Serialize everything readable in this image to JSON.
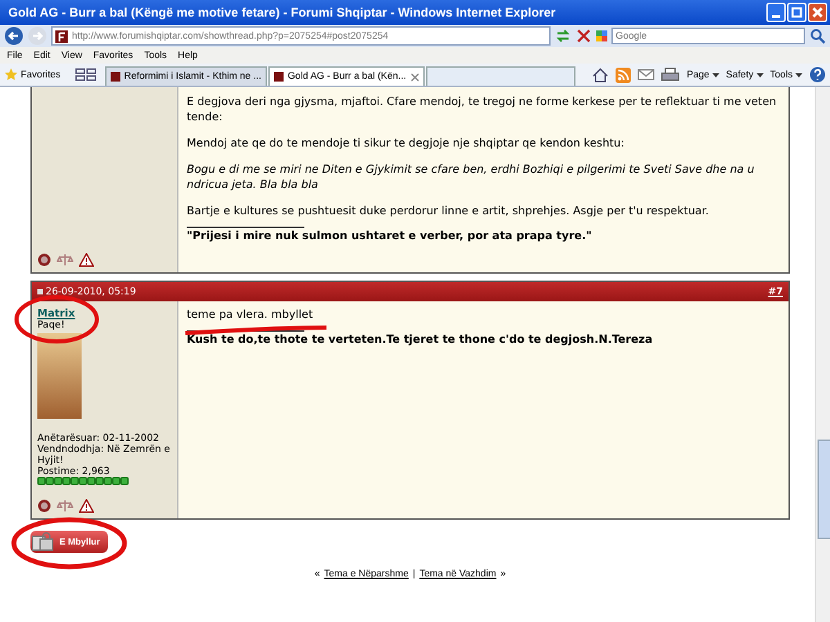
{
  "window": {
    "title": "Gold AG - Burr a bal (Këngë me motive fetare) - Forumi Shqiptar - Windows Internet Explorer"
  },
  "address_bar": {
    "value": "http://www.forumishqiptar.com/showthread.php?p=2075254#post2075254"
  },
  "search": {
    "placeholder": "Google"
  },
  "menu": [
    "File",
    "Edit",
    "View",
    "Favorites",
    "Tools",
    "Help"
  ],
  "favorites_bar": {
    "label": "Favorites",
    "tabs": [
      {
        "label": "Reformimi i Islamit - Kthim ne ...",
        "selected": false
      },
      {
        "label": "Gold AG - Burr a bal (Kën...",
        "selected": true
      }
    ],
    "commands": [
      "Page",
      "Safety",
      "Tools"
    ]
  },
  "posts": [
    {
      "paragraphs": [
        {
          "kind": "text",
          "text": "E degjova deri nga gjysma, mjaftoi. Cfare mendoj, te tregoj ne forme kerkese per te reflektuar ti me veten tende:"
        },
        {
          "kind": "text",
          "text": "Mendoj ate qe do te mendoje ti sikur te degjoje nje shqiptar qe kendon keshtu:"
        },
        {
          "kind": "italic",
          "text": "Bogu e di me se miri ne Diten e Gjykimit se cfare ben, erdhi Bozhiqi e pilgerimi te Sveti Save dhe na u ndricua jeta. Bla bla bla"
        },
        {
          "kind": "text",
          "text": "Bartje e kultures se pushtuesit duke perdorur linne e artit, shprehjes. Asgje per t'u respektuar."
        }
      ],
      "signature": "\"Prijesi i mire nuk sulmon ushtaret e verber, por ata prapa tyre.\""
    },
    {
      "date": "26-09-2010, 05:19",
      "number": "#7",
      "user": "Matrix",
      "user_title": "Paqe!",
      "user_info": [
        "Anëtarësuar: 02-11-2002",
        "Vendndodhja: Në Zemrën e Hyjit!",
        "Postime: 2,963"
      ],
      "paragraphs": [
        {
          "kind": "text",
          "text": "teme pa vlera. mbyllet"
        }
      ],
      "signature": "Kush te do,te thote te verteten.Te tjeret te thone c'do te degjosh.N.Tereza"
    }
  ],
  "closed_button": "E Mbyllur",
  "thread_nav": {
    "prev_mark": "«",
    "prev": "Tema e Nëparshme",
    "separator": "|",
    "next": "Tema në Vazhdim",
    "next_mark": "»"
  }
}
